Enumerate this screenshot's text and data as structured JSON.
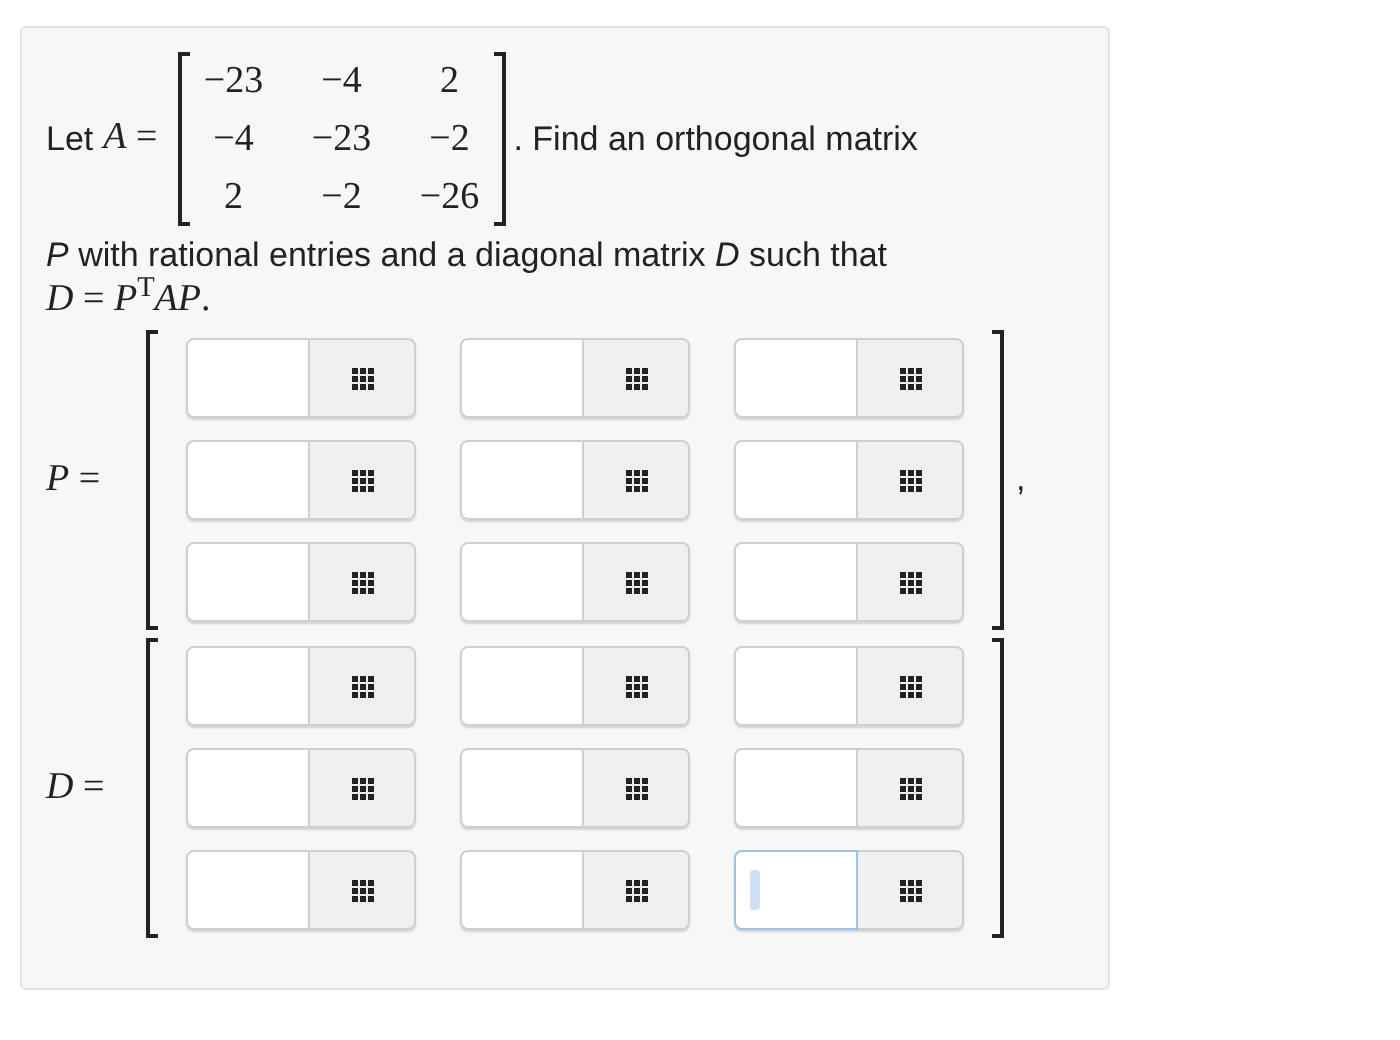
{
  "prompt": {
    "lead": "Let",
    "matrix_label": "*A* =",
    "matrix": [
      [
        "−23",
        "−4",
        "2"
      ],
      [
        "−4",
        "−23",
        "−2"
      ],
      [
        "2",
        "−2",
        "−26"
      ]
    ],
    "after": ". Find an orthogonal matrix",
    "line2": "*P* with rational entries and a diagonal matrix *D* such that",
    "line3": "*D* = *P*$^{T}$*AP*."
  },
  "answers": [
    {
      "label": "*P* =",
      "trailing": ",",
      "rows": [
        [
          {
            "focused": false
          },
          {
            "focused": false
          },
          {
            "focused": false
          }
        ],
        [
          {
            "focused": false
          },
          {
            "focused": false
          },
          {
            "focused": false
          }
        ],
        [
          {
            "focused": false
          },
          {
            "focused": false
          },
          {
            "focused": false
          }
        ]
      ]
    },
    {
      "label": "*D* =",
      "rows": [
        [
          {
            "focused": false
          },
          {
            "focused": false
          },
          {
            "focused": false
          }
        ],
        [
          {
            "focused": false
          },
          {
            "focused": false
          },
          {
            "focused": false
          }
        ],
        [
          {
            "focused": false
          },
          {
            "focused": false
          },
          {
            "focused": true
          }
        ]
      ]
    }
  ]
}
